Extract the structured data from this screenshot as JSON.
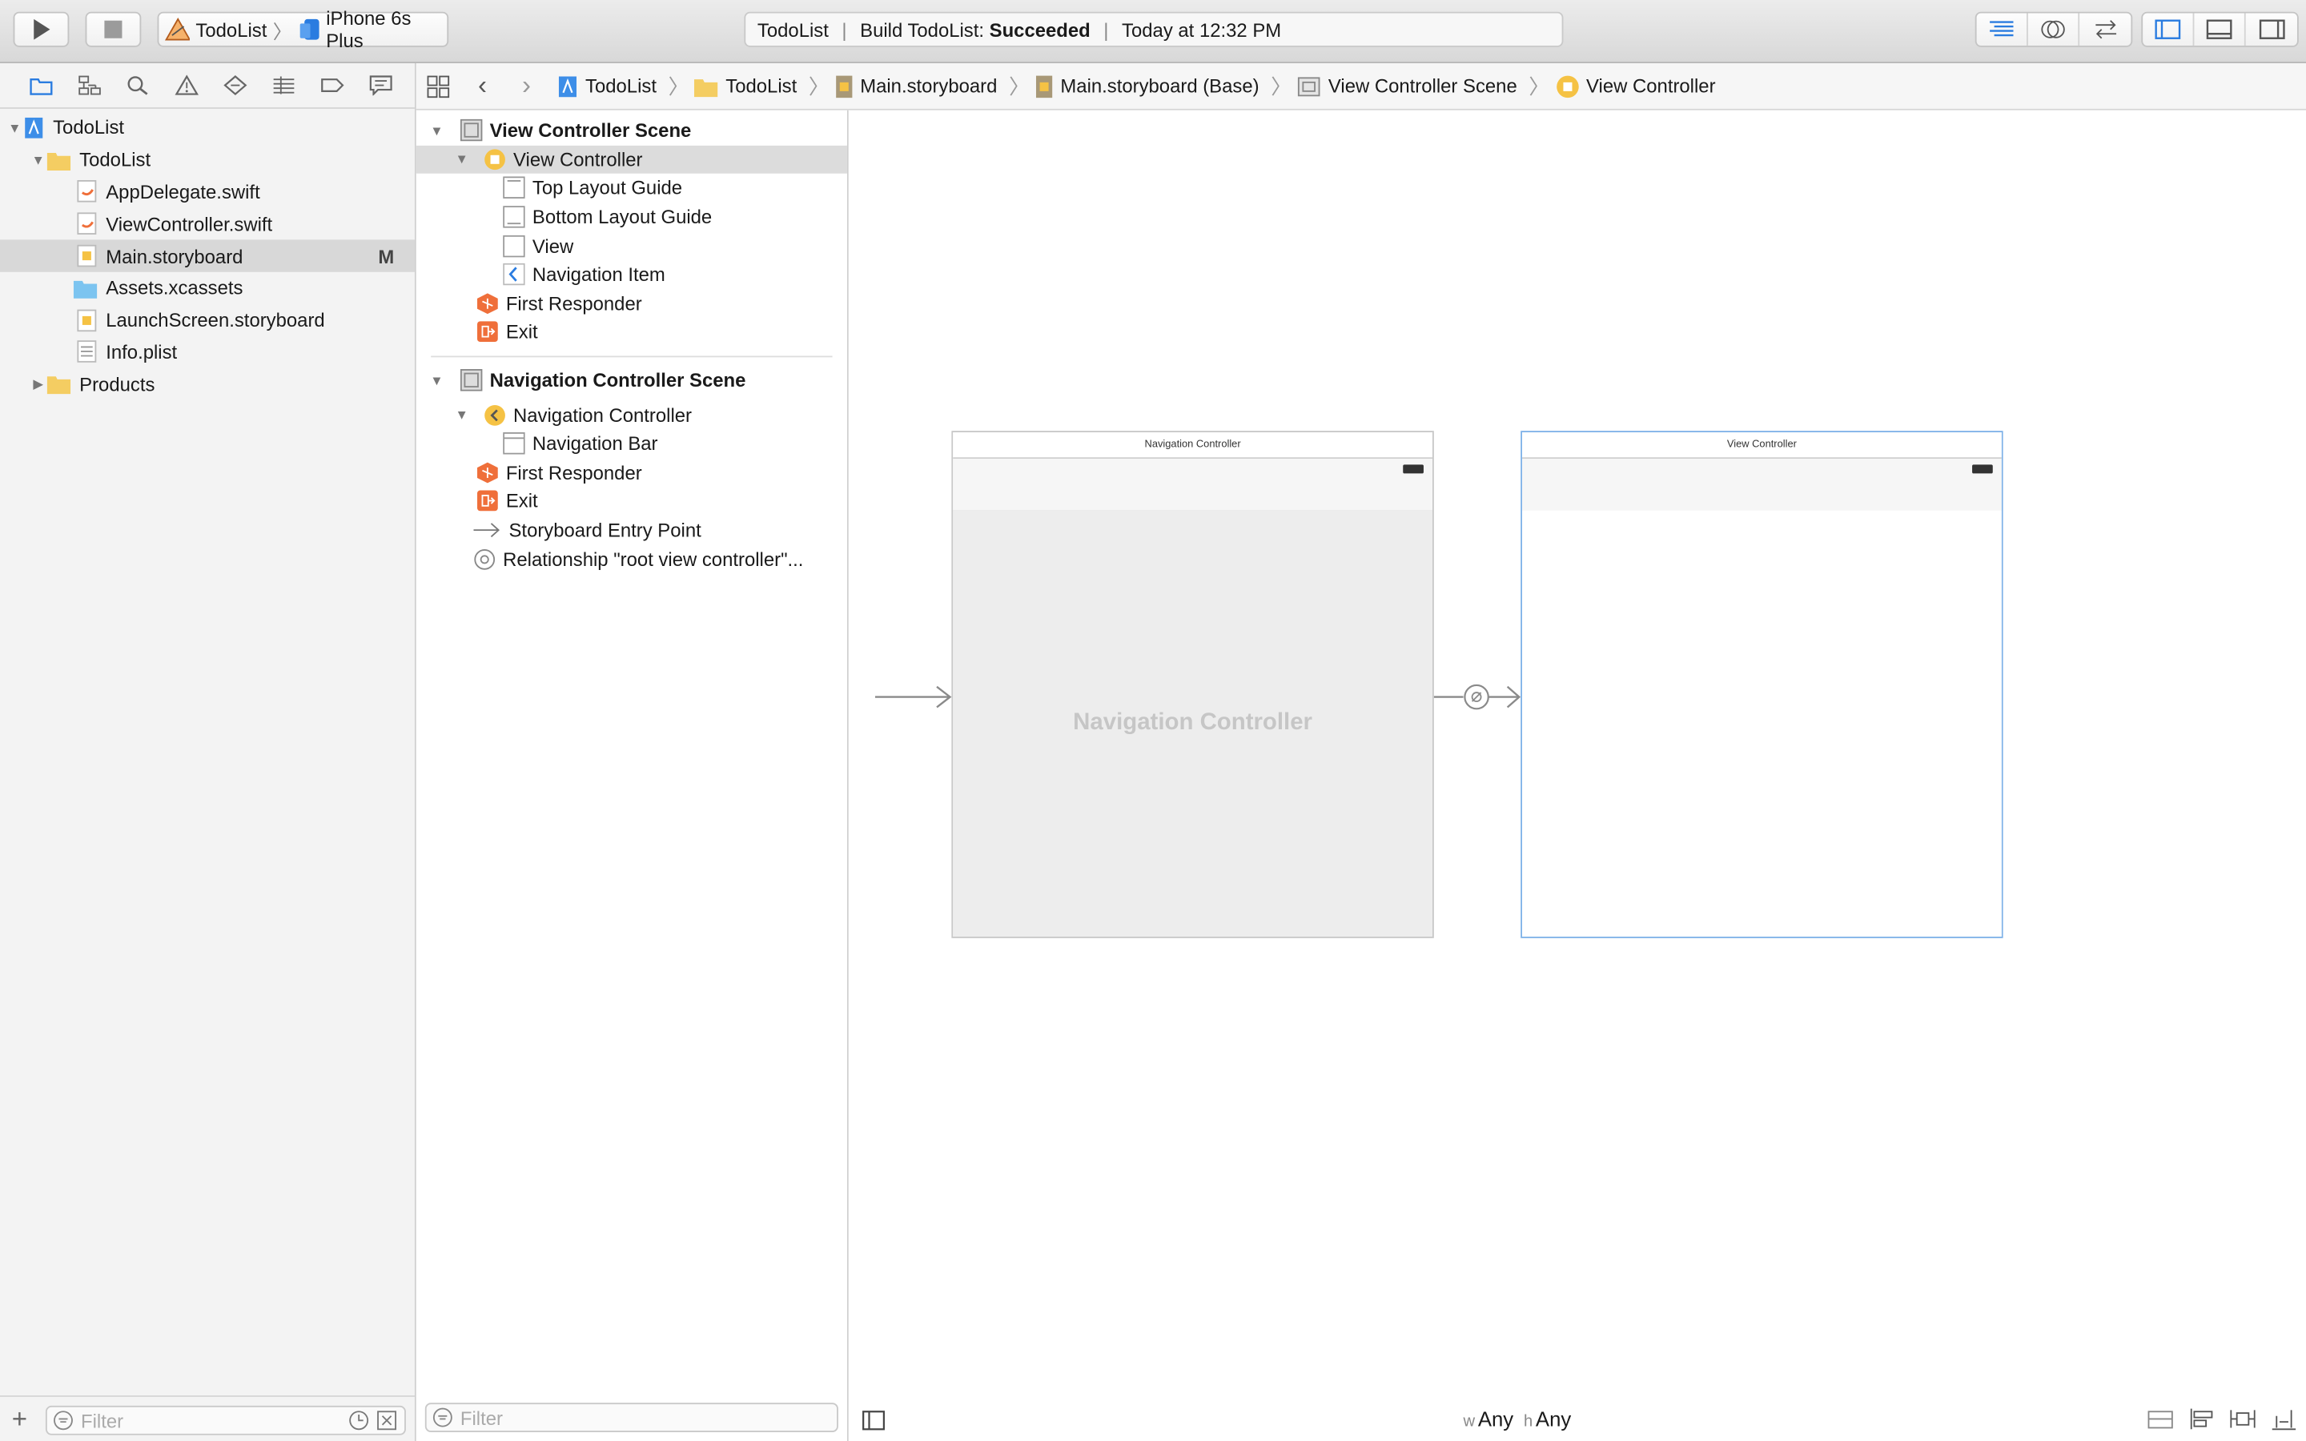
{
  "toolbar": {
    "scheme_name": "TodoList",
    "device_name": "iPhone 6s Plus",
    "status_project": "TodoList",
    "status_build_prefix": "Build TodoList: ",
    "status_build_result": "Succeeded",
    "status_time": "Today at 12:32 PM"
  },
  "navigator": {
    "items": [
      {
        "label": "TodoList"
      },
      {
        "label": "TodoList"
      },
      {
        "label": "AppDelegate.swift"
      },
      {
        "label": "ViewController.swift"
      },
      {
        "label": "Main.storyboard",
        "badge": "M"
      },
      {
        "label": "Assets.xcassets"
      },
      {
        "label": "LaunchScreen.storyboard"
      },
      {
        "label": "Info.plist"
      },
      {
        "label": "Products"
      }
    ],
    "filter_placeholder": "Filter"
  },
  "jumpbar": {
    "crumbs": [
      "TodoList",
      "TodoList",
      "Main.storyboard",
      "Main.storyboard (Base)",
      "View Controller Scene",
      "View Controller"
    ]
  },
  "outline": {
    "scene1": {
      "title": "View Controller Scene",
      "items": [
        "View Controller",
        "Top Layout Guide",
        "Bottom Layout Guide",
        "View",
        "Navigation Item",
        "First Responder",
        "Exit"
      ]
    },
    "scene2": {
      "title": "Navigation Controller Scene",
      "items": [
        "Navigation Controller",
        "Navigation Bar",
        "First Responder",
        "Exit",
        "Storyboard Entry Point",
        "Relationship \"root view controller\"..."
      ]
    },
    "filter_placeholder": "Filter"
  },
  "canvas": {
    "nav_scene_title": "Navigation Controller",
    "nav_scene_watermark": "Navigation Controller",
    "vc_scene_title": "View Controller",
    "size_class_w_prefix": "w",
    "size_class_w": "Any",
    "size_class_h_prefix": "h",
    "size_class_h": "Any"
  },
  "colors": {
    "accent": "#2a7ce0",
    "folder": "#f4cd62",
    "orange": "#ef6f3a",
    "yellow": "#f5c244"
  }
}
